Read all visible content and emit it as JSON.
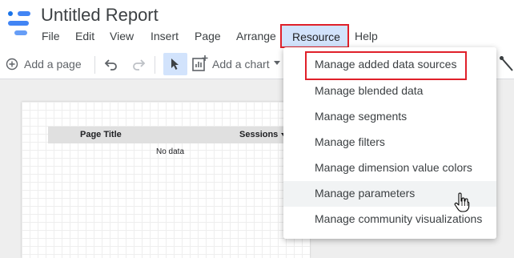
{
  "header": {
    "title": "Untitled Report",
    "menu": [
      "File",
      "Edit",
      "View",
      "Insert",
      "Page",
      "Arrange",
      "Resource",
      "Help"
    ]
  },
  "toolbar": {
    "add_page": "Add a page",
    "add_chart": "Add a chart"
  },
  "report": {
    "columns": [
      "Page Title",
      "Sessions"
    ],
    "empty_text": "No data"
  },
  "resource_menu": {
    "items": [
      "Manage added data sources",
      "Manage blended data",
      "Manage segments",
      "Manage filters",
      "Manage dimension value colors",
      "Manage parameters",
      "Manage community visualizations"
    ],
    "hovered_index": 5,
    "outlined_index": 0
  },
  "colors": {
    "highlight_outline": "#e0202a",
    "active_menu_bg": "#d2e3fc",
    "logo_blue": "#4285f4"
  }
}
